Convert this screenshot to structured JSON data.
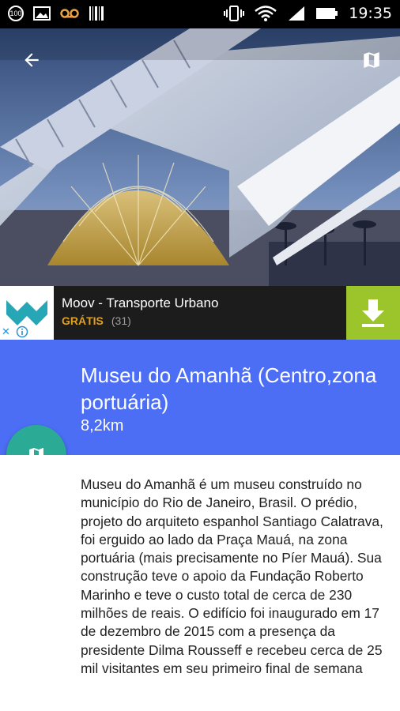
{
  "status_bar": {
    "notification_badge": "100",
    "time": "19:35",
    "icons": [
      "badge-100-icon",
      "image-icon",
      "voicemail-icon",
      "barcode-icon",
      "vibrate-icon",
      "wifi-icon",
      "signal-icon",
      "battery-icon"
    ]
  },
  "hero": {
    "back_icon": "arrow-back-icon",
    "map_icon": "map-icon"
  },
  "ad": {
    "title": "Moov - Transporte Urbano",
    "price": "GRÁTIS",
    "count": "(31)",
    "download_icon": "download-icon",
    "close_label": "✕"
  },
  "place": {
    "name": "Museu do Amanhã (Centro,zona portuária)",
    "distance": "8,2km"
  },
  "description": "Museu do Amanhã é um museu construído no município do Rio de Janeiro, Brasil. O prédio, projeto do arquiteto espanhol Santiago Calatrava, foi erguido ao lado da Praça Mauá, na zona portuária (mais precisamente no Píer Mauá). Sua construção teve o apoio da Fundação Roberto Marinho e teve o custo total de cerca de 230 milhões de reais. O edifício foi inaugurado em 17 de dezembro de 2015 com a presença da presidente Dilma Rousseff e recebeu cerca de 25 mil visitantes em seu primeiro final de semana",
  "colors": {
    "title_bg": "#4c6ef5",
    "fab_bg": "#2baa96",
    "ad_bg": "#1c1c1c",
    "download_bg": "#9cc52c",
    "price": "#e0a020"
  }
}
